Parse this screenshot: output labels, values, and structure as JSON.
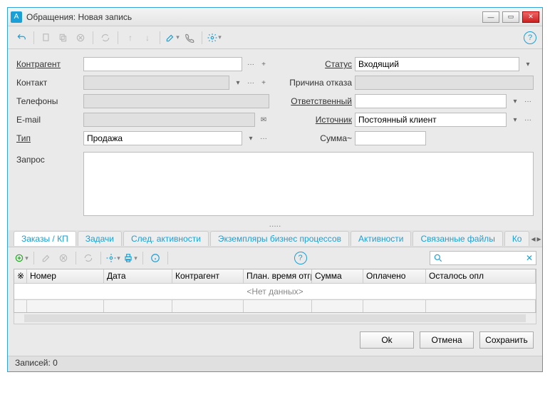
{
  "window": {
    "title": "Обращения: Новая запись"
  },
  "form": {
    "left": {
      "contractor_label": "Контрагент",
      "contact_label": "Контакт",
      "phones_label": "Телефоны",
      "email_label": "E-mail",
      "type_label": "Тип",
      "type_value": "Продажа"
    },
    "right": {
      "status_label": "Статус",
      "status_value": "Входящий",
      "reject_reason_label": "Причина отказа",
      "responsible_label": "Ответственный",
      "source_label": "Источник",
      "source_value": "Постоянный клиент",
      "sum_label": "Сумма~"
    },
    "request_label": "Запрос"
  },
  "tabs": {
    "items": [
      "Заказы / КП",
      "Задачи",
      "След. активности",
      "Экземпляры бизнес процессов",
      "Активности",
      "Связанные файлы",
      "Ко"
    ]
  },
  "grid": {
    "headers": [
      "Номер",
      "Дата",
      "Контрагент",
      "План. время отгр",
      "Сумма",
      "Оплачено",
      "Осталось опл"
    ],
    "empty": "<Нет данных>"
  },
  "buttons": {
    "ok": "Ok",
    "cancel": "Отмена",
    "save": "Сохранить"
  },
  "status": "Записей: 0",
  "dots": "....."
}
